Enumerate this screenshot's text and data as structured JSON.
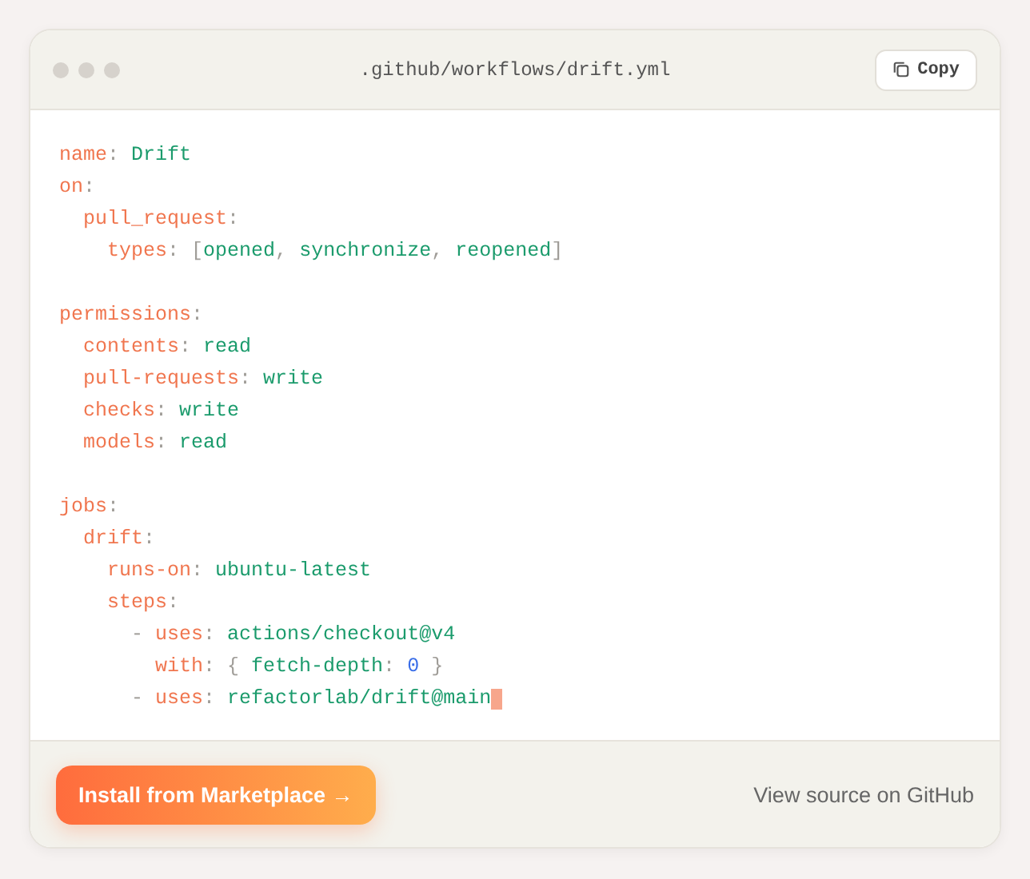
{
  "window": {
    "title": ".github/workflows/drift.yml",
    "copy_button": "Copy"
  },
  "code_lines": [
    {
      "kind": "code",
      "tokens": [
        {
          "kind": "key",
          "text": "name"
        },
        {
          "kind": "punct",
          "text": ": "
        },
        {
          "kind": "value",
          "text": "Drift"
        }
      ]
    },
    {
      "kind": "code",
      "tokens": [
        {
          "kind": "key",
          "text": "on"
        },
        {
          "kind": "punct",
          "text": ":"
        }
      ]
    },
    {
      "kind": "code",
      "tokens": [
        {
          "kind": "key",
          "text": "  pull_request"
        },
        {
          "kind": "punct",
          "text": ":"
        }
      ]
    },
    {
      "kind": "code",
      "tokens": [
        {
          "kind": "key",
          "text": "    types"
        },
        {
          "kind": "punct",
          "text": ": ["
        },
        {
          "kind": "value",
          "text": "opened"
        },
        {
          "kind": "punct",
          "text": ", "
        },
        {
          "kind": "value",
          "text": "synchronize"
        },
        {
          "kind": "punct",
          "text": ", "
        },
        {
          "kind": "value",
          "text": "reopened"
        },
        {
          "kind": "punct",
          "text": "]"
        }
      ]
    },
    {
      "kind": "blank"
    },
    {
      "kind": "code",
      "tokens": [
        {
          "kind": "key",
          "text": "permissions"
        },
        {
          "kind": "punct",
          "text": ":"
        }
      ]
    },
    {
      "kind": "code",
      "tokens": [
        {
          "kind": "key",
          "text": "  contents"
        },
        {
          "kind": "punct",
          "text": ": "
        },
        {
          "kind": "value",
          "text": "read"
        }
      ]
    },
    {
      "kind": "code",
      "tokens": [
        {
          "kind": "key",
          "text": "  pull-requests"
        },
        {
          "kind": "punct",
          "text": ": "
        },
        {
          "kind": "value",
          "text": "write"
        }
      ]
    },
    {
      "kind": "code",
      "tokens": [
        {
          "kind": "key",
          "text": "  checks"
        },
        {
          "kind": "punct",
          "text": ": "
        },
        {
          "kind": "value",
          "text": "write"
        }
      ]
    },
    {
      "kind": "code",
      "tokens": [
        {
          "kind": "key",
          "text": "  models"
        },
        {
          "kind": "punct",
          "text": ": "
        },
        {
          "kind": "value",
          "text": "read"
        }
      ]
    },
    {
      "kind": "blank"
    },
    {
      "kind": "code",
      "tokens": [
        {
          "kind": "key",
          "text": "jobs"
        },
        {
          "kind": "punct",
          "text": ":"
        }
      ]
    },
    {
      "kind": "code",
      "tokens": [
        {
          "kind": "key",
          "text": "  drift"
        },
        {
          "kind": "punct",
          "text": ":"
        }
      ]
    },
    {
      "kind": "code",
      "tokens": [
        {
          "kind": "key",
          "text": "    runs-on"
        },
        {
          "kind": "punct",
          "text": ": "
        },
        {
          "kind": "value",
          "text": "ubuntu-latest"
        }
      ]
    },
    {
      "kind": "code",
      "tokens": [
        {
          "kind": "key",
          "text": "    steps"
        },
        {
          "kind": "punct",
          "text": ":"
        }
      ]
    },
    {
      "kind": "code",
      "tokens": [
        {
          "kind": "punct",
          "text": "      - "
        },
        {
          "kind": "key",
          "text": "uses"
        },
        {
          "kind": "punct",
          "text": ": "
        },
        {
          "kind": "value",
          "text": "actions/checkout@v4"
        }
      ]
    },
    {
      "kind": "code",
      "tokens": [
        {
          "kind": "key",
          "text": "        with"
        },
        {
          "kind": "punct",
          "text": ": { "
        },
        {
          "kind": "value",
          "text": "fetch-depth"
        },
        {
          "kind": "punct",
          "text": ": "
        },
        {
          "kind": "number",
          "text": "0"
        },
        {
          "kind": "punct",
          "text": " }"
        }
      ]
    },
    {
      "kind": "code",
      "cursor": true,
      "tokens": [
        {
          "kind": "punct",
          "text": "      - "
        },
        {
          "kind": "key",
          "text": "uses"
        },
        {
          "kind": "punct",
          "text": ": "
        },
        {
          "kind": "value",
          "text": "refactorlab/drift@main"
        }
      ]
    }
  ],
  "footer": {
    "primary_button": "Install from Marketplace →",
    "link": "View source on GitHub"
  }
}
